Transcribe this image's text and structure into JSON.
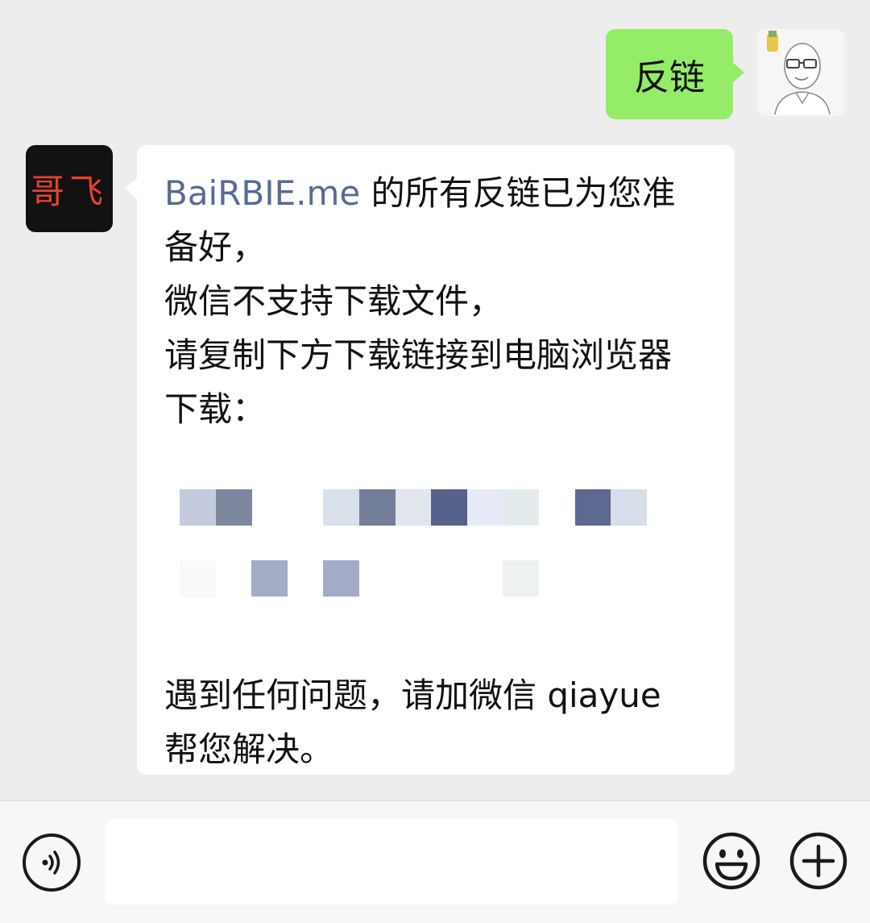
{
  "messages": {
    "outgoing": {
      "text": "反链"
    },
    "incoming": {
      "avatar_text": "哥飞",
      "link_text": "BaiRBIE.me",
      "line1_rest": " 的所有反链已为您准",
      "line2": "备好，",
      "line3": "微信不支持下载文件，",
      "line4": "请复制下方下载链接到电脑浏览器",
      "line5": "下载：",
      "line6": "遇到任何问题，请加微信 qiayue",
      "line7": "帮您解决。"
    }
  },
  "pixelated_rows": [
    [
      "#c4cbdd",
      "#7d889f",
      "",
      "",
      "#d8e0ea",
      "#737e98",
      "#e0e6ec",
      "#56628c",
      "#e6eaf6",
      "#e4ebec",
      "",
      "#5d6990",
      "#d7dde9"
    ],
    [
      "#f8fafb",
      "",
      "#a3adc6",
      "",
      "#a3abc7",
      "",
      "",
      "",
      "",
      "#edf2f1",
      "",
      "",
      ""
    ]
  ],
  "input_bar": {
    "input_value": "",
    "icons": {
      "voice": "voice-icon",
      "emoji": "emoji-icon",
      "plus": "plus-icon"
    }
  },
  "colors": {
    "background": "#ededed",
    "outgoing_bubble": "#95ec69",
    "incoming_bubble": "#ffffff",
    "link": "#576b95",
    "bot_avatar_bg": "#121212",
    "bot_avatar_text": "#e8422f"
  }
}
